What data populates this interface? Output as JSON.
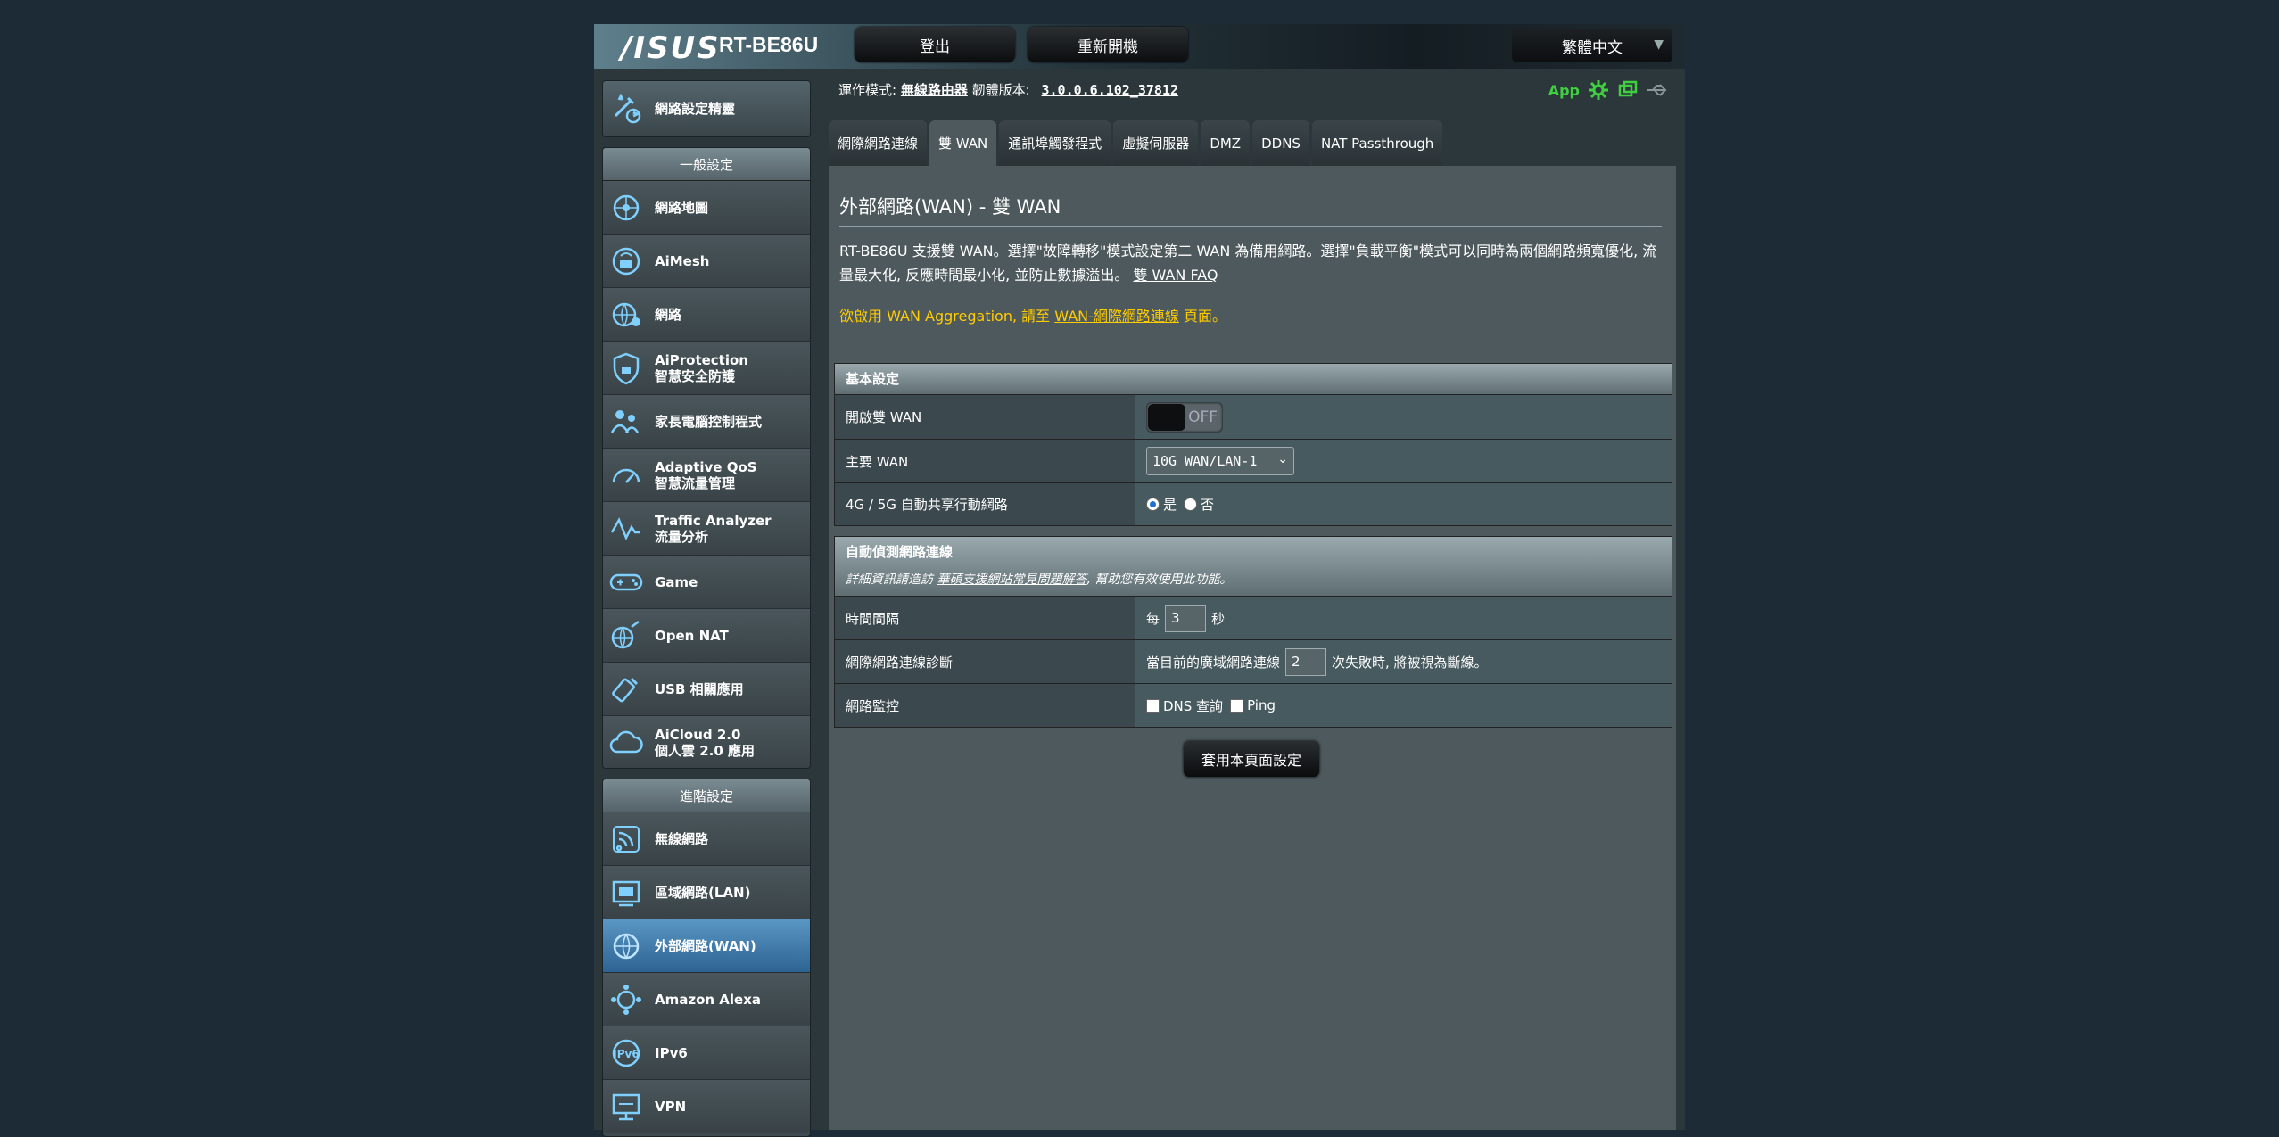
{
  "header": {
    "brand": "/ISUS",
    "model": "RT-BE86U",
    "logout_label": "登出",
    "reboot_label": "重新開機",
    "language": "繁體中文"
  },
  "sidebar": {
    "wizard_label": "網路設定精靈",
    "general_title": "一般設定",
    "general_items": [
      {
        "label": "網路地圖",
        "icon": "network-map-icon"
      },
      {
        "label": "AiMesh",
        "icon": "aimesh-icon"
      },
      {
        "label": "網路",
        "icon": "guest-network-icon"
      },
      {
        "label": "AiProtection",
        "label2": "智慧安全防護",
        "icon": "shield-icon"
      },
      {
        "label": "家長電腦控制程式",
        "icon": "parental-control-icon"
      },
      {
        "label": "Adaptive QoS",
        "label2": "智慧流量管理",
        "icon": "speedometer-icon"
      },
      {
        "label": "Traffic Analyzer",
        "label2": "流量分析",
        "icon": "traffic-analyzer-icon"
      },
      {
        "label": "Game",
        "icon": "gamepad-icon"
      },
      {
        "label": "Open NAT",
        "icon": "open-nat-icon"
      },
      {
        "label": "USB 相關應用",
        "icon": "usb-icon"
      },
      {
        "label": "AiCloud 2.0",
        "label2": "個人雲 2.0 應用",
        "icon": "cloud-icon"
      }
    ],
    "advanced_title": "進階設定",
    "advanced_items": [
      {
        "label": "無線網路",
        "icon": "wireless-icon"
      },
      {
        "label": "區域網路(LAN)",
        "icon": "lan-icon"
      },
      {
        "label": "外部網路(WAN)",
        "icon": "wan-globe-icon",
        "active": true
      },
      {
        "label": "Amazon Alexa",
        "icon": "alexa-icon"
      },
      {
        "label": "IPv6",
        "icon": "ipv6-icon"
      },
      {
        "label": "VPN",
        "icon": "vpn-icon"
      }
    ]
  },
  "status": {
    "mode_label": "運作模式:",
    "mode_value": "無線路由器",
    "fw_label": "韌體版本:",
    "fw_value": "3.0.0.6.102_37812",
    "app_label": "App",
    "accent_green": "#3fcf3f"
  },
  "tabs": [
    "網際網路連線",
    "雙 WAN",
    "通訊埠觸發程式",
    "虛擬伺服器",
    "DMZ",
    "DDNS",
    "NAT Passthrough"
  ],
  "page": {
    "title": "外部網路(WAN) - 雙 WAN",
    "description": "RT-BE86U 支援雙 WAN。選擇\"故障轉移\"模式設定第二 WAN 為備用網路。選擇\"負載平衡\"模式可以同時為兩個網路頻寬優化, 流量最大化, 反應時間最小化, 並防止數據溢出。",
    "faq_link": "雙 WAN FAQ",
    "agg_prefix": "欲啟用 WAN Aggregation, 請至",
    "agg_link": "WAN-網際網路連線",
    "agg_suffix": "頁面。",
    "note_color": "#ffcc00"
  },
  "basic": {
    "header": "基本設定",
    "enable_label": "開啟雙 WAN",
    "enable_state": "OFF",
    "primary_label": "主要 WAN",
    "primary_value": "10G WAN/LAN-1",
    "mobile_label": "4G / 5G 自動共享行動網路",
    "yes_label": "是",
    "no_label": "否",
    "mobile_selected": "是"
  },
  "detect": {
    "header": "自動偵測網路連線",
    "note_prefix": "詳細資訊請造訪",
    "note_link": "華碩支援網站常見問題解答",
    "note_suffix": ", 幫助您有效使用此功能。",
    "interval_label": "時間間隔",
    "interval_prefix": "每",
    "interval_value": "3",
    "interval_suffix": "秒",
    "diag_label": "網際網路連線診斷",
    "diag_prefix": "當目前的廣域網路連線",
    "diag_value": "2",
    "diag_suffix": "次失敗時, 將被視為斷線。",
    "monitor_label": "網路監控",
    "dns_label": "DNS 查詢",
    "ping_label": "Ping"
  },
  "apply_label": "套用本頁面設定"
}
